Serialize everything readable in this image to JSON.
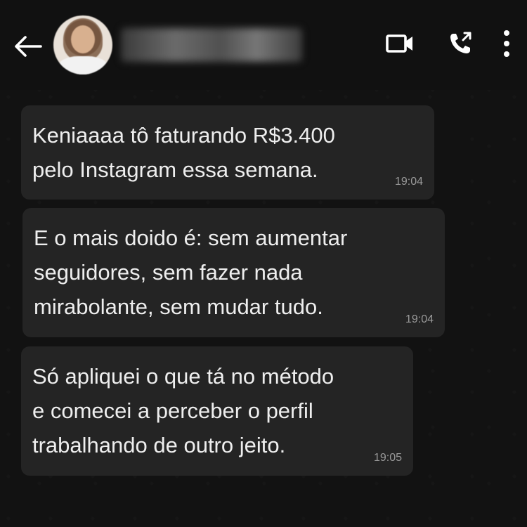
{
  "header": {
    "back_icon": "arrow-left-icon",
    "avatar_icon": "contact-avatar",
    "contact_name": "",
    "actions": [
      {
        "icon": "video-call-icon"
      },
      {
        "icon": "voice-call-icon"
      },
      {
        "icon": "more-vertical-icon"
      }
    ]
  },
  "messages": [
    {
      "text": "Keniaaaa tô faturando R$3.400\npelo Instagram essa semana.",
      "time": "19:04"
    },
    {
      "text": "E o mais doido é: sem aumentar\nseguidores, sem fazer nada\nmirabolante, sem mudar tudo.",
      "time": "19:04"
    },
    {
      "text": "Só apliquei o que tá no método\ne comecei a perceber o perfil\ntrabalhando de outro jeito.",
      "time": "19:05"
    }
  ],
  "colors": {
    "background": "#121212",
    "bubble": "#242424",
    "text": "#eeeeee",
    "timestamp": "#9a9a9a"
  }
}
